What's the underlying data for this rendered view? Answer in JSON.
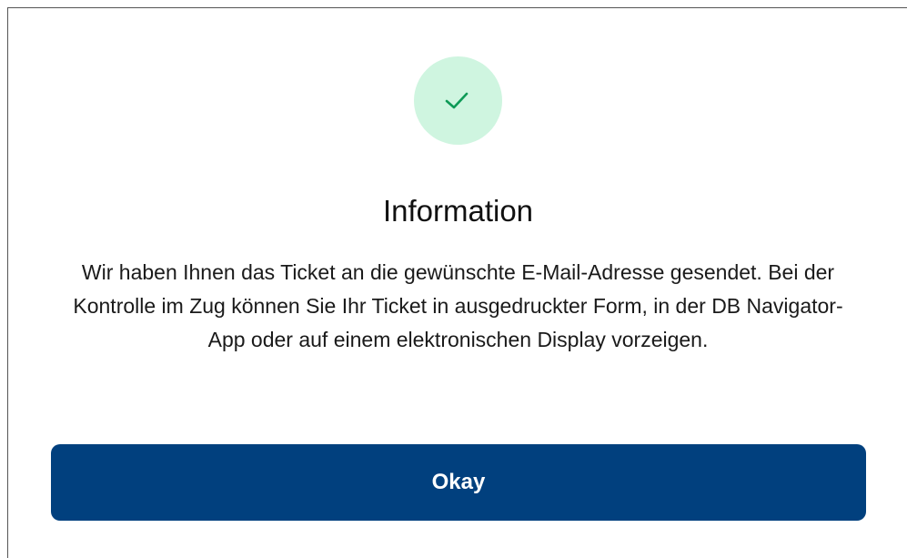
{
  "dialog": {
    "status_icon": "check-icon",
    "title": "Information",
    "message": "Wir haben Ihnen das Ticket an die gewünschte E-Mail-Adresse gesendet. Bei der Kontrolle im Zug können Sie Ihr Ticket in ausgedruckter Form, in der DB Navigator-App oder auf einem elektronischen Display vorzeigen.",
    "confirm_label": "Okay"
  },
  "colors": {
    "primary_button": "#01407e",
    "success_bg": "#cff5e0",
    "success_check": "#0e9a57"
  }
}
